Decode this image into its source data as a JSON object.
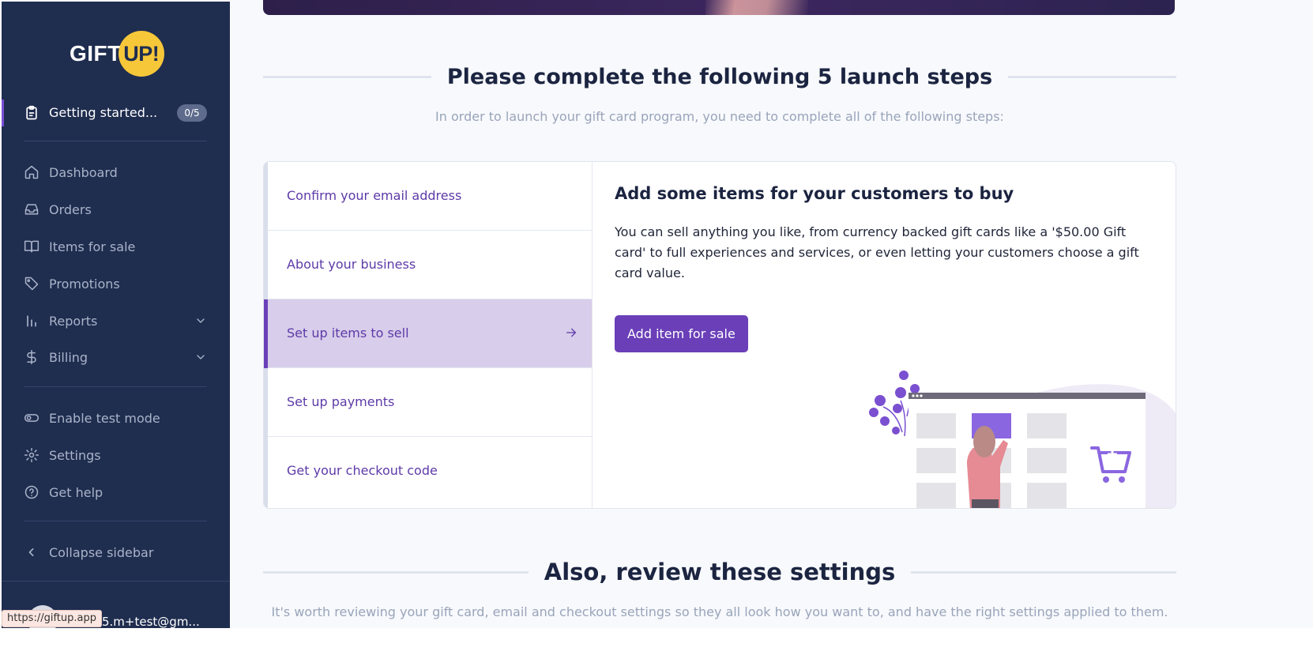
{
  "sidebar": {
    "logo": {
      "gift": "GIFT",
      "up": "UP!"
    },
    "getting_started": {
      "label": "Getting started...",
      "badge": "0/5",
      "icon": "clipboard-icon"
    },
    "nav": [
      {
        "label": "Dashboard",
        "icon": "home-icon"
      },
      {
        "label": "Orders",
        "icon": "inbox-icon"
      },
      {
        "label": "Items for sale",
        "icon": "book-icon"
      },
      {
        "label": "Promotions",
        "icon": "tag-icon"
      },
      {
        "label": "Reports",
        "icon": "bar-chart-icon",
        "expandable": true
      },
      {
        "label": "Billing",
        "icon": "dollar-icon",
        "expandable": true
      }
    ],
    "secondary": [
      {
        "label": "Enable test mode",
        "icon": "toggle-icon"
      },
      {
        "label": "Settings",
        "icon": "gear-icon"
      },
      {
        "label": "Get help",
        "icon": "help-circle-icon"
      }
    ],
    "collapse": {
      "label": "Collapse sidebar",
      "icon": "chevron-left-icon"
    },
    "user": {
      "email": "5.m+test@gm..."
    },
    "status_url": "https://giftup.app"
  },
  "main": {
    "launch": {
      "title": "Please complete the following 5 launch steps",
      "subtitle": "In order to launch your gift card program, you need to complete all of the following steps:"
    },
    "steps": [
      {
        "label": "Confirm your email address",
        "active": false
      },
      {
        "label": "About your business",
        "active": false
      },
      {
        "label": "Set up items to sell",
        "active": true
      },
      {
        "label": "Set up payments",
        "active": false
      },
      {
        "label": "Get your checkout code",
        "active": false
      }
    ],
    "detail": {
      "title": "Add some items for your customers to buy",
      "description": "You can sell anything you like, from currency backed gift cards like a '$50.00 Gift card' to full experiences and services, or even letting your customers choose a gift card value.",
      "button": "Add item for sale"
    },
    "review": {
      "title": "Also, review these settings",
      "subtitle": "It's worth reviewing your gift card, email and checkout settings so they all look how you want to, and have the right settings applied to them."
    }
  },
  "colors": {
    "sidebar_bg": "#1f2d4f",
    "accent": "#6a3fb8",
    "active_step_bg": "#d8cdea",
    "logo_yellow": "#f7c73a"
  }
}
